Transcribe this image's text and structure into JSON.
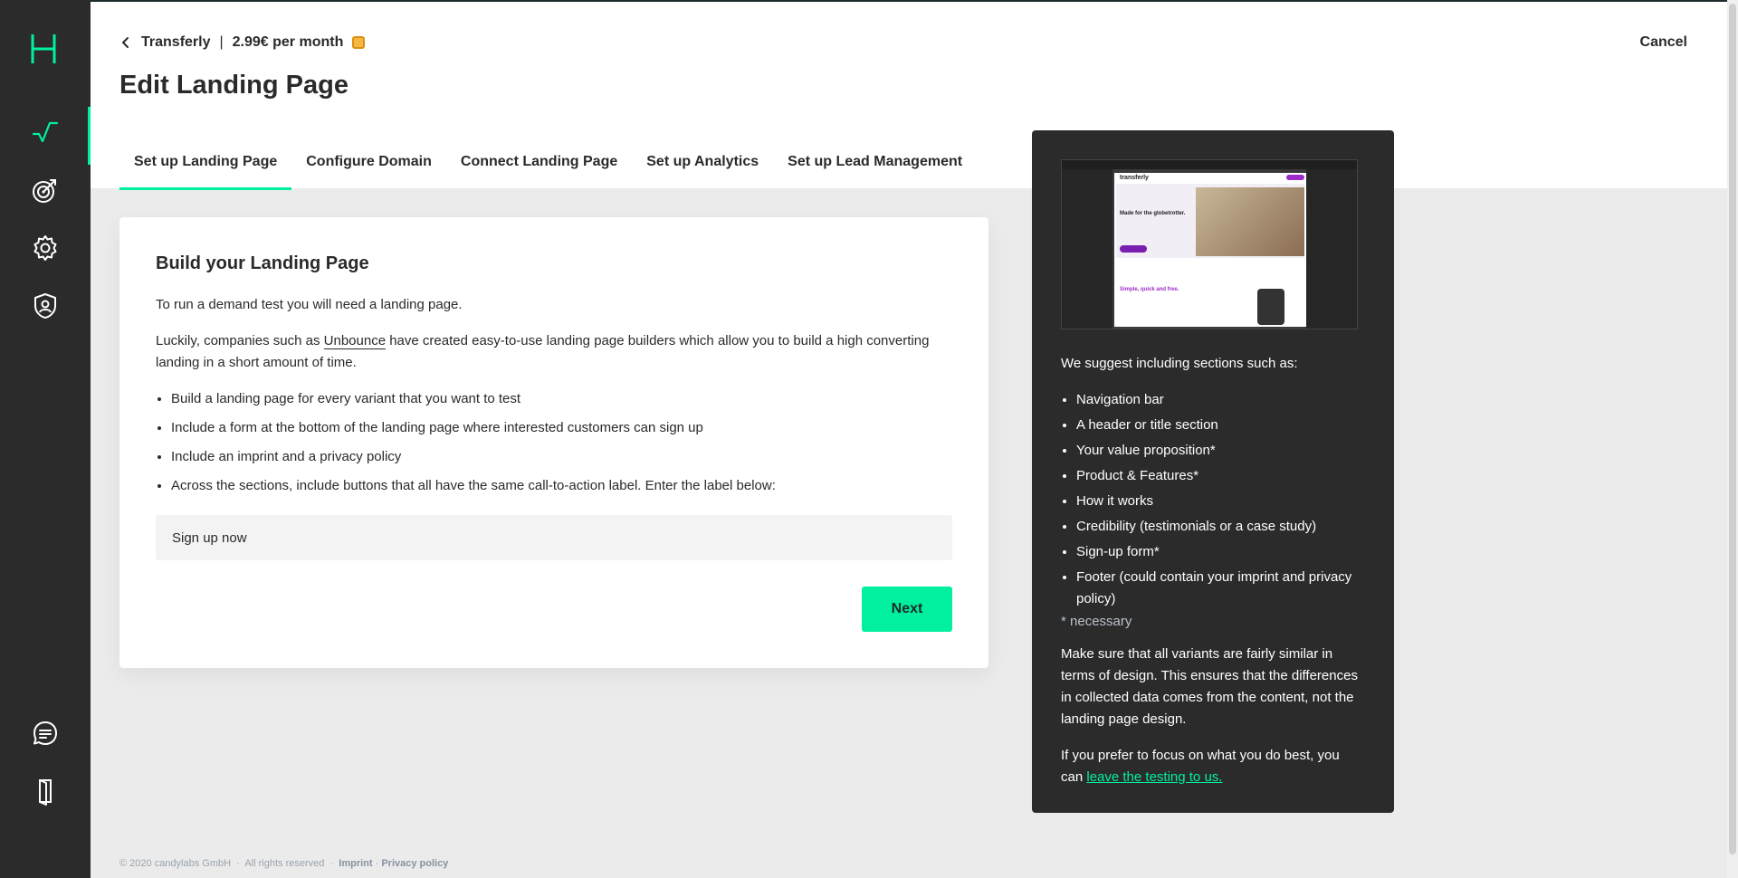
{
  "header": {
    "breadcrumb_project": "Transferly",
    "breadcrumb_separator": "|",
    "breadcrumb_price": "2.99€ per month",
    "title": "Edit Landing Page",
    "cancel_label": "Cancel"
  },
  "tabs": [
    {
      "label": "Set up Landing Page"
    },
    {
      "label": "Configure Domain"
    },
    {
      "label": "Connect Landing Page"
    },
    {
      "label": "Set up Analytics"
    },
    {
      "label": "Set up Lead Management"
    }
  ],
  "card": {
    "title": "Build your Landing Page",
    "intro": "To run a demand test you will need a landing page.",
    "p2_before": "Luckily, companies such as",
    "p2_link": "Unbounce",
    "p2_after": "have created easy-to-use landing page builders which allow you to build a high converting landing in a short amount of time.",
    "bullets": [
      "Build a landing page for every variant that you want to test",
      "Include a form at the bottom of the landing page where interested customers can sign up",
      "Include an imprint and a privacy policy",
      "Across the sections, include buttons that all have the same call-to-action label. Enter the label below:"
    ],
    "cta_value": "Sign up now",
    "next_label": "Next"
  },
  "panel": {
    "preview": {
      "brand": "transferly",
      "headline": "Made for the globetrotter.",
      "section_title": "Simple, quick and free."
    },
    "intro": "We suggest including sections such as:",
    "items": [
      "Navigation bar",
      "A header or title section",
      "Your value proposition*",
      "Product & Features*",
      "How it works",
      "Credibility (testimonials or a case study)",
      "Sign-up form*",
      "Footer (could contain your imprint and privacy policy)"
    ],
    "note": "* necessary",
    "p_design": "Make sure that all variants are fairly similar in terms of design. This ensures that the differences in collected data comes from the content, not the landing page design.",
    "p_focus": "If you prefer to focus on what you do best, you can",
    "link_label": "leave the testing to us."
  },
  "footer": {
    "copyright": "© 2020 candylabs GmbH",
    "rights": "All rights reserved",
    "imprint": "Imprint",
    "privacy": "Privacy policy"
  },
  "colors": {
    "accent": "#00f0a0",
    "sidebar": "#2b2b2b",
    "panel": "#2b2b2b",
    "badge": "#f5b840"
  },
  "icons": {
    "logo": "h-logo-icon",
    "nav": [
      "chart-icon",
      "target-icon",
      "gear-icon",
      "shield-user-icon",
      "chat-icon",
      "door-icon"
    ]
  }
}
